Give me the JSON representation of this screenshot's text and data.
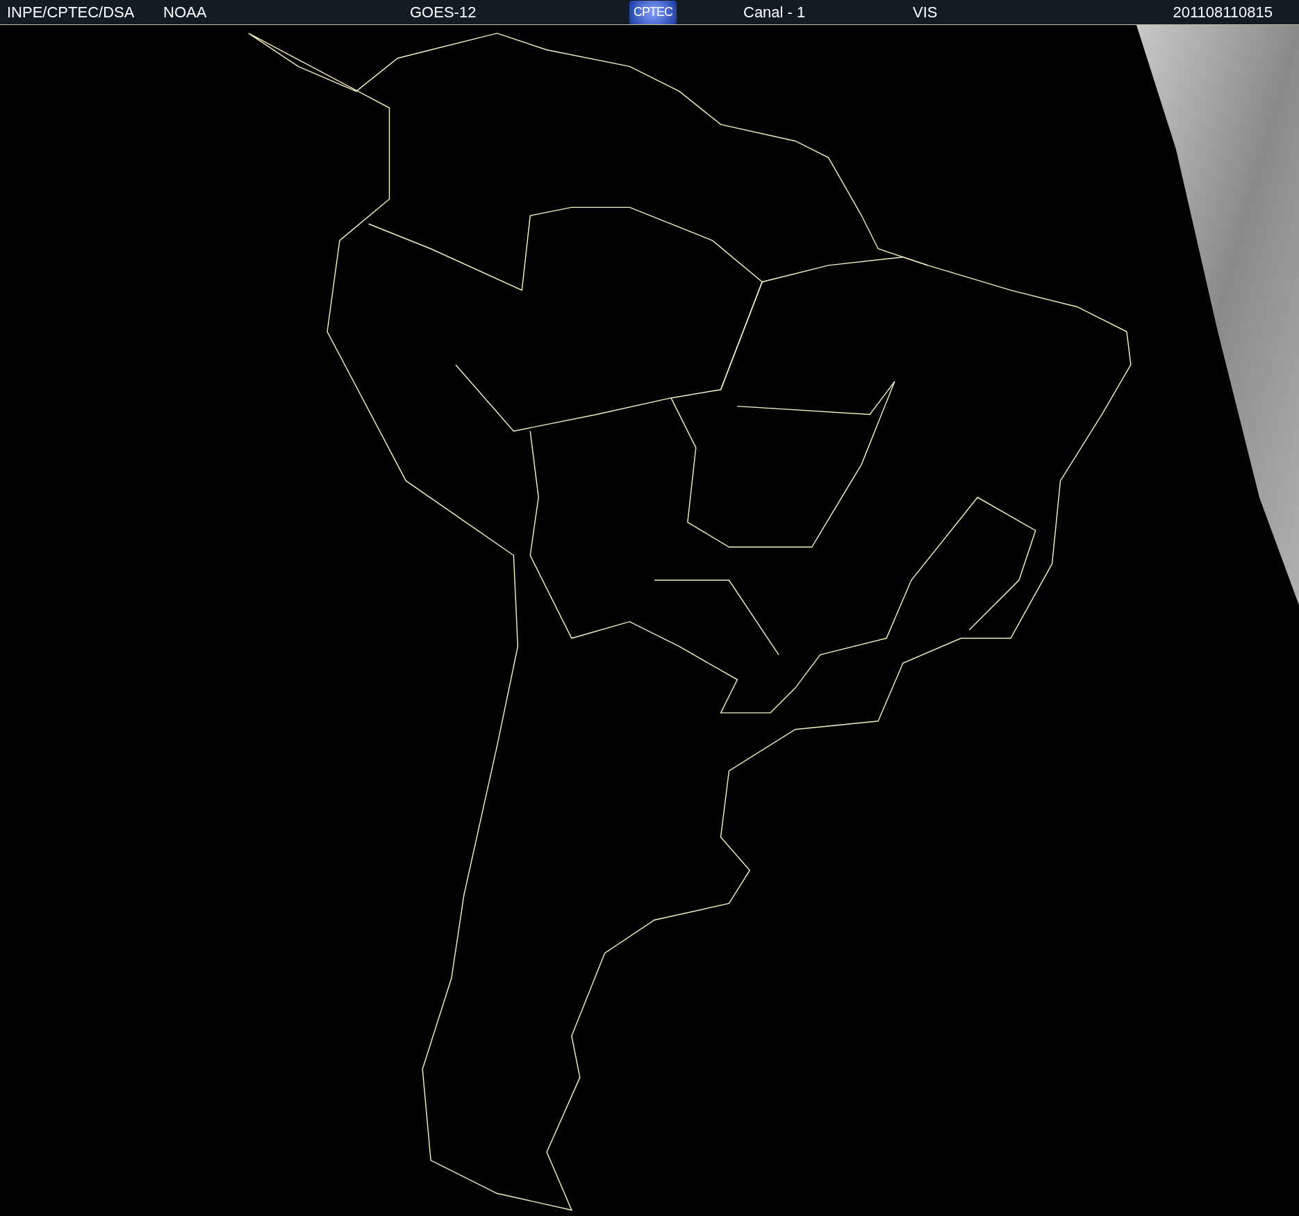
{
  "header": {
    "source": "INPE/CPTEC/DSA",
    "agency": "NOAA",
    "satellite": "GOES-12",
    "logo": "CPTEC",
    "channel": "Canal - 1",
    "band": "VIS",
    "timestamp": "201108110815"
  }
}
